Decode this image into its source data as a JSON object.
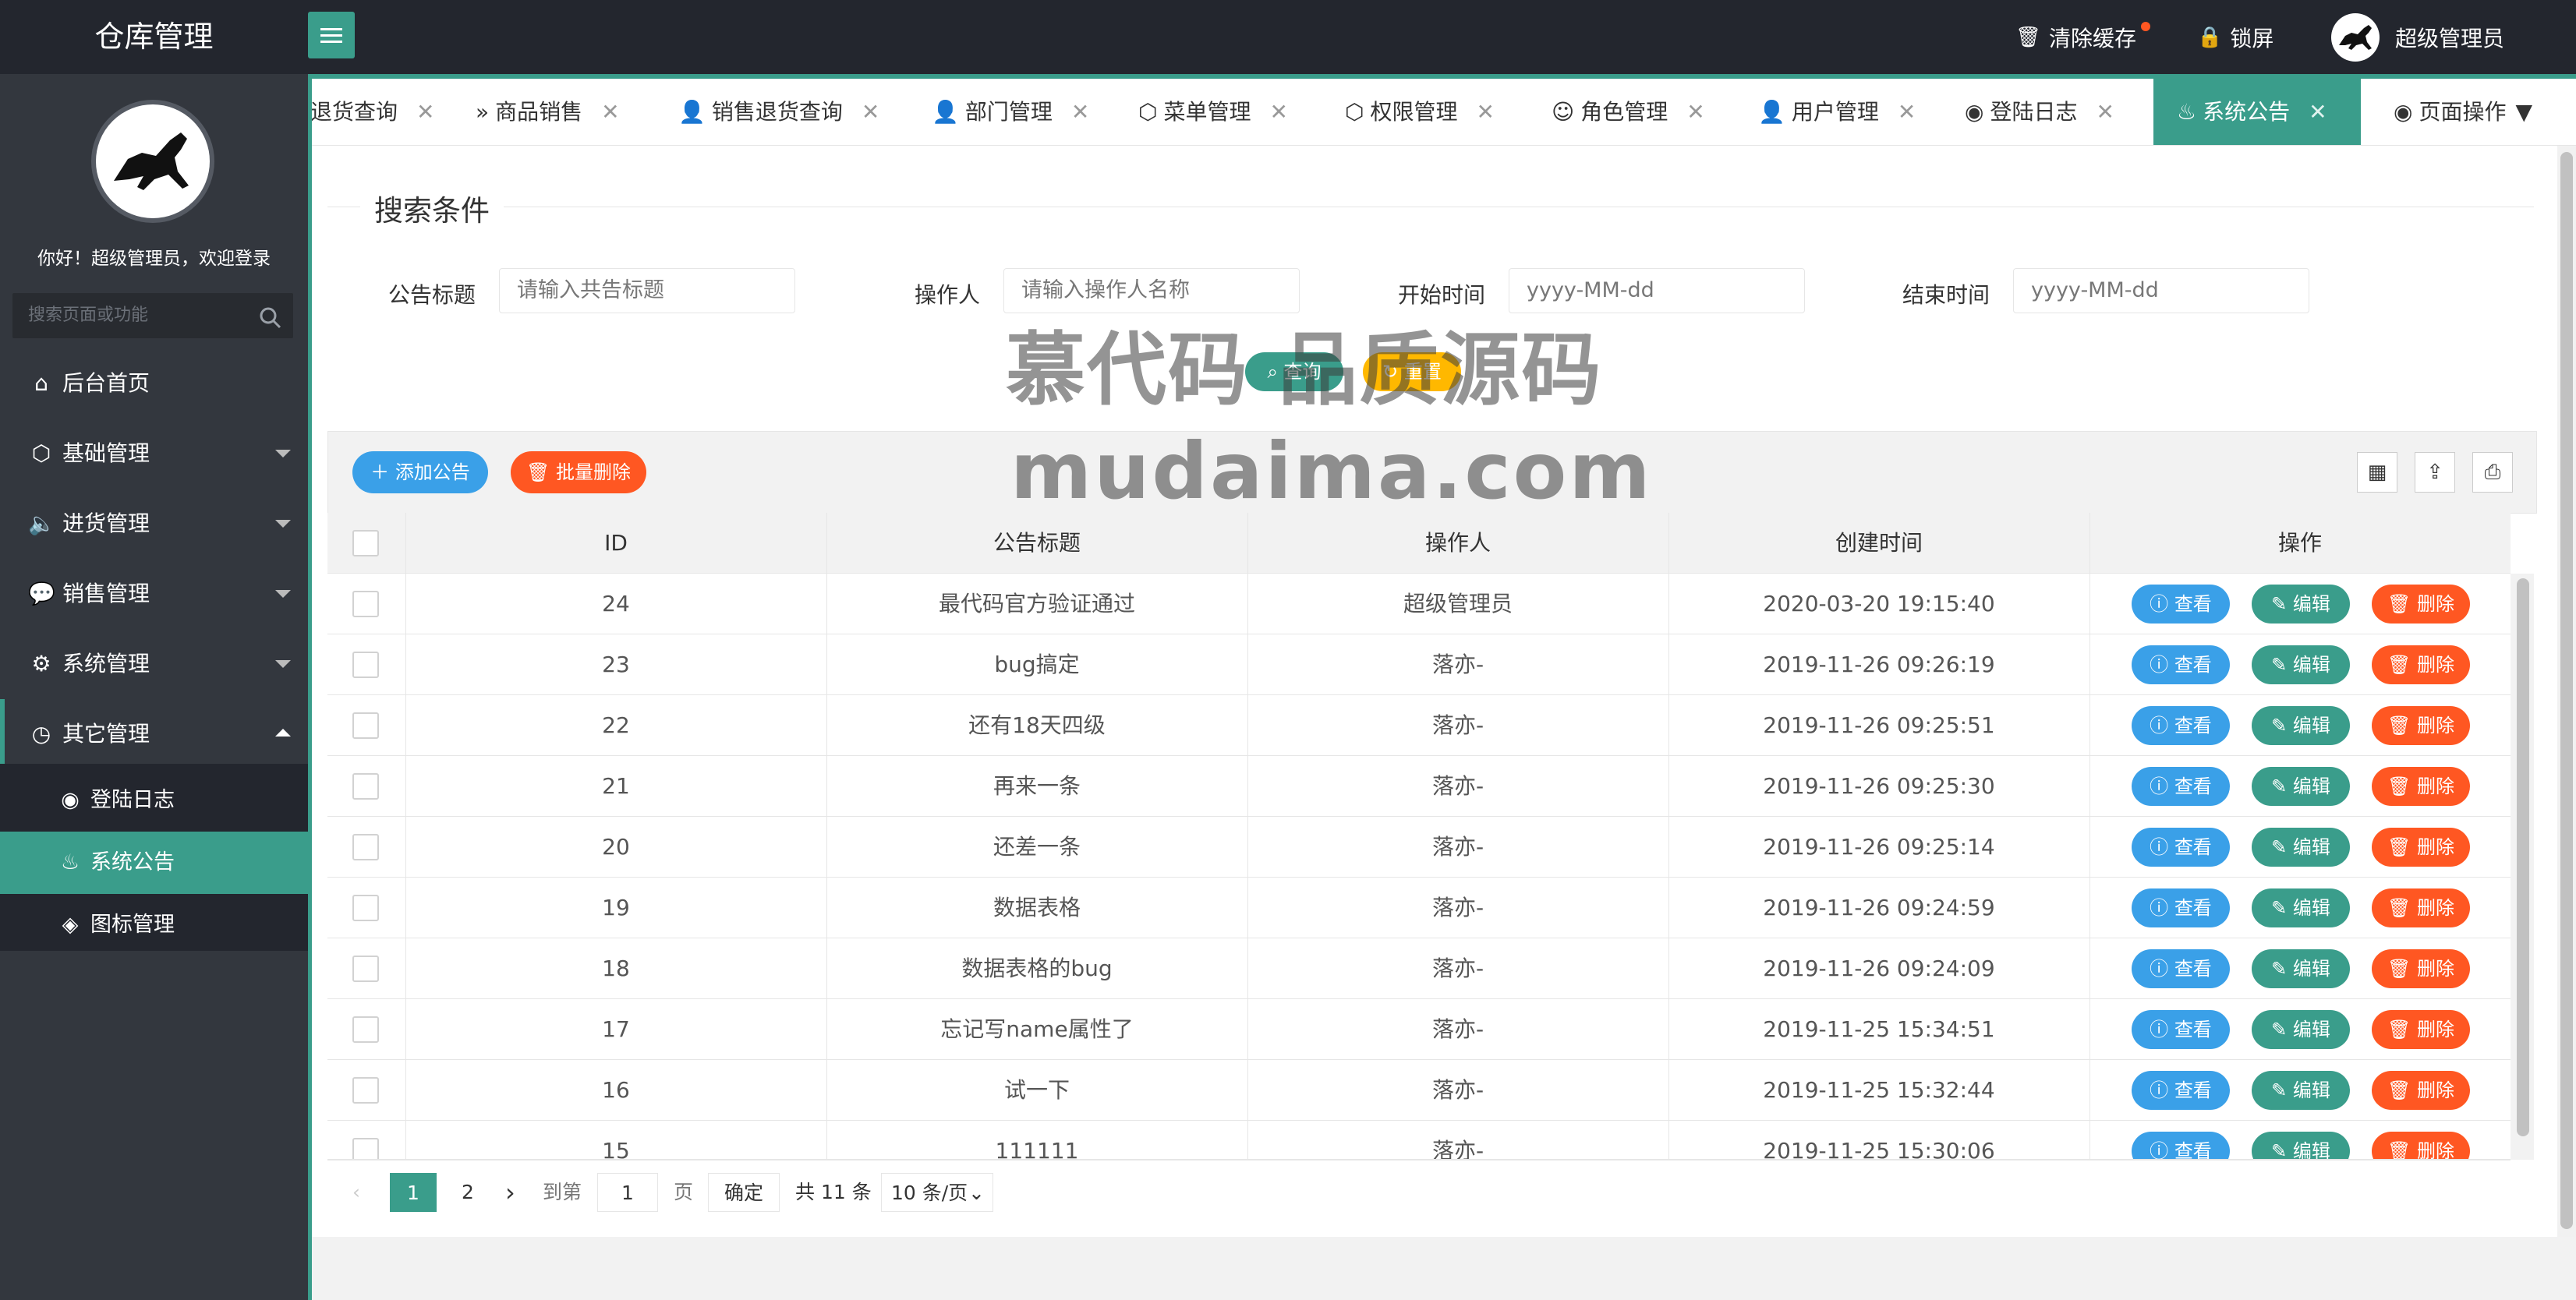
{
  "app": {
    "title": "仓库管理"
  },
  "header": {
    "clear_cache": "清除缓存",
    "lock_screen": "锁屏",
    "user_name": "超级管理员"
  },
  "sidebar": {
    "welcome": "你好！超级管理员，欢迎登录",
    "search_placeholder": "搜索页面或功能",
    "items": [
      {
        "label": "后台首页",
        "icon": "home-icon"
      },
      {
        "label": "基础管理",
        "icon": "cube-icon"
      },
      {
        "label": "进货管理",
        "icon": "speaker-icon"
      },
      {
        "label": "销售管理",
        "icon": "chat-icon"
      },
      {
        "label": "系统管理",
        "icon": "gear-icon"
      },
      {
        "label": "其它管理",
        "icon": "clock-icon"
      }
    ],
    "sub_items": [
      {
        "label": "登陆日志",
        "icon": "weibo-icon"
      },
      {
        "label": "系统公告",
        "icon": "fire-icon"
      },
      {
        "label": "图标管理",
        "icon": "compass-icon"
      }
    ]
  },
  "tabs": [
    {
      "label": "退货查询"
    },
    {
      "label": "商品销售"
    },
    {
      "label": "销售退货查询"
    },
    {
      "label": "部门管理"
    },
    {
      "label": "菜单管理"
    },
    {
      "label": "权限管理"
    },
    {
      "label": "角色管理"
    },
    {
      "label": "用户管理"
    },
    {
      "label": "登陆日志"
    },
    {
      "label": "系统公告"
    }
  ],
  "page_ops": "页面操作",
  "search": {
    "legend": "搜索条件",
    "fields": [
      {
        "label": "公告标题",
        "placeholder": "请输入共告标题"
      },
      {
        "label": "操作人",
        "placeholder": "请输入操作人名称"
      },
      {
        "label": "开始时间",
        "placeholder": "yyyy-MM-dd"
      },
      {
        "label": "结束时间",
        "placeholder": "yyyy-MM-dd"
      }
    ],
    "query_label": "查询",
    "reset_label": "重置"
  },
  "toolbar": {
    "add_label": "添加公告",
    "batch_delete_label": "批量删除"
  },
  "table": {
    "columns": [
      "ID",
      "公告标题",
      "操作人",
      "创建时间",
      "操作"
    ],
    "actions": {
      "view": "查看",
      "edit": "编辑",
      "delete": "删除"
    },
    "rows": [
      {
        "id": "24",
        "title": "最代码官方验证通过",
        "operator": "超级管理员",
        "created": "2020-03-20 19:15:40"
      },
      {
        "id": "23",
        "title": "bug搞定",
        "operator": "落亦-",
        "created": "2019-11-26 09:26:19"
      },
      {
        "id": "22",
        "title": "还有18天四级",
        "operator": "落亦-",
        "created": "2019-11-26 09:25:51"
      },
      {
        "id": "21",
        "title": "再来一条",
        "operator": "落亦-",
        "created": "2019-11-26 09:25:30"
      },
      {
        "id": "20",
        "title": "还差一条",
        "operator": "落亦-",
        "created": "2019-11-26 09:25:14"
      },
      {
        "id": "19",
        "title": "数据表格",
        "operator": "落亦-",
        "created": "2019-11-26 09:24:59"
      },
      {
        "id": "18",
        "title": "数据表格的bug",
        "operator": "落亦-",
        "created": "2019-11-26 09:24:09"
      },
      {
        "id": "17",
        "title": "忘记写name属性了",
        "operator": "落亦-",
        "created": "2019-11-25 15:34:51"
      },
      {
        "id": "16",
        "title": "试一下",
        "operator": "落亦-",
        "created": "2019-11-25 15:32:44"
      },
      {
        "id": "15",
        "title": "111111",
        "operator": "落亦-",
        "created": "2019-11-25 15:30:06"
      }
    ]
  },
  "pager": {
    "page1": "1",
    "page2": "2",
    "goto_label": "到第",
    "page_input": "1",
    "page_unit": "页",
    "confirm": "确定",
    "total": "共 11 条",
    "page_size": "10 条/页"
  },
  "watermark": {
    "line1": "慕代码 品质源码",
    "line2": "mudaima.com"
  },
  "colors": {
    "accent": "#3a9d8b",
    "header_bg": "#23262e",
    "sidebar_bg": "#33373e",
    "view": "#3aa0e8",
    "delete": "#ff5722"
  }
}
